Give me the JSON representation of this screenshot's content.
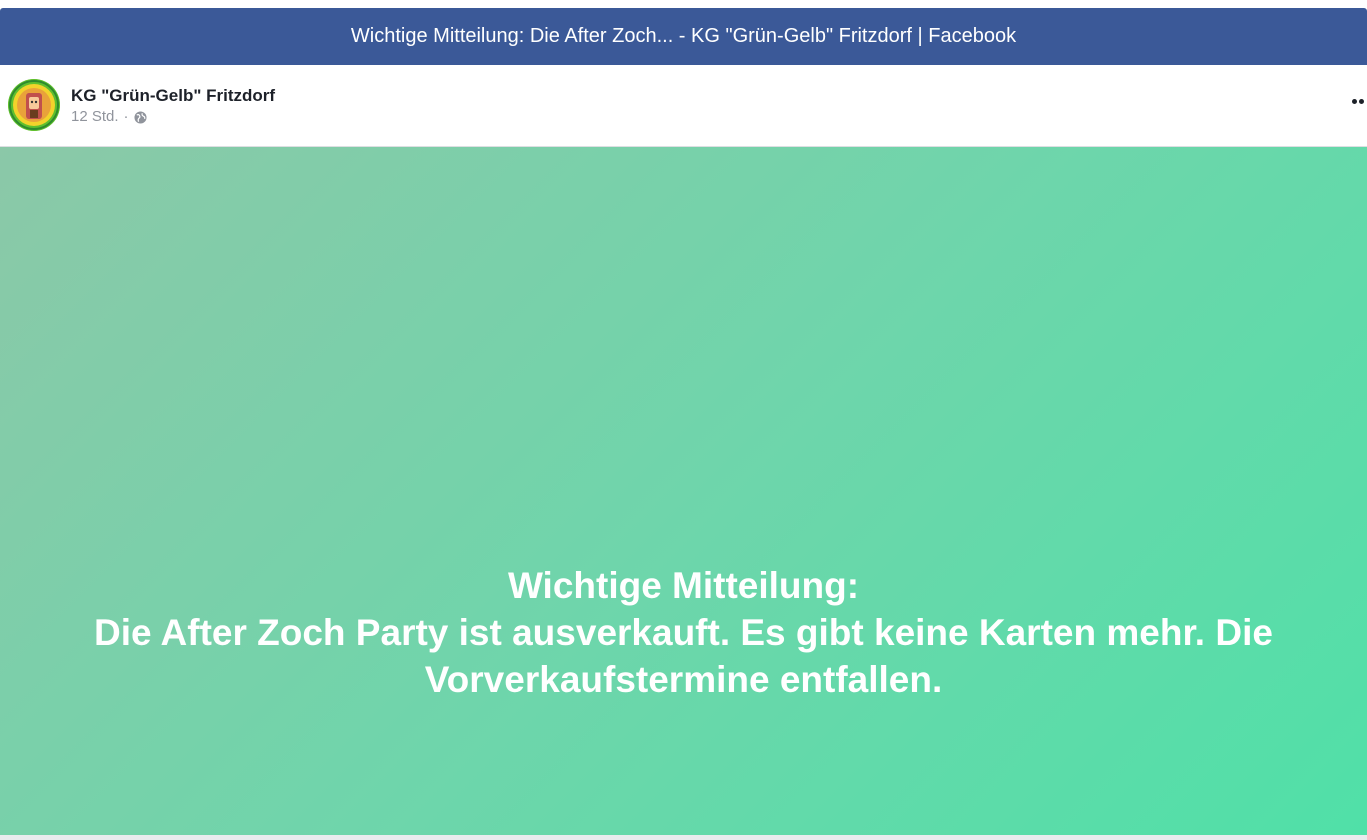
{
  "window": {
    "title": "Wichtige Mitteilung: Die After Zoch... - KG \"Grün-Gelb\" Fritzdorf | Facebook"
  },
  "post": {
    "page_name": "KG \"Grün-Gelb\" Fritzdorf",
    "timestamp": "12 Std.",
    "separator": "·",
    "privacy_icon": "globe-icon",
    "more_icon": "more-options-icon",
    "text_line_1": "Wichtige Mitteilung:",
    "text_line_2": "Die After Zoch Party ist ausverkauft. Es gibt keine Karten mehr. Die Vorverkaufstermine entfallen."
  },
  "colors": {
    "titlebar": "#3b5998",
    "gradient_start": "#8bc8a8",
    "gradient_end": "#50e0a8",
    "text": "#ffffff",
    "meta": "#90949c"
  }
}
